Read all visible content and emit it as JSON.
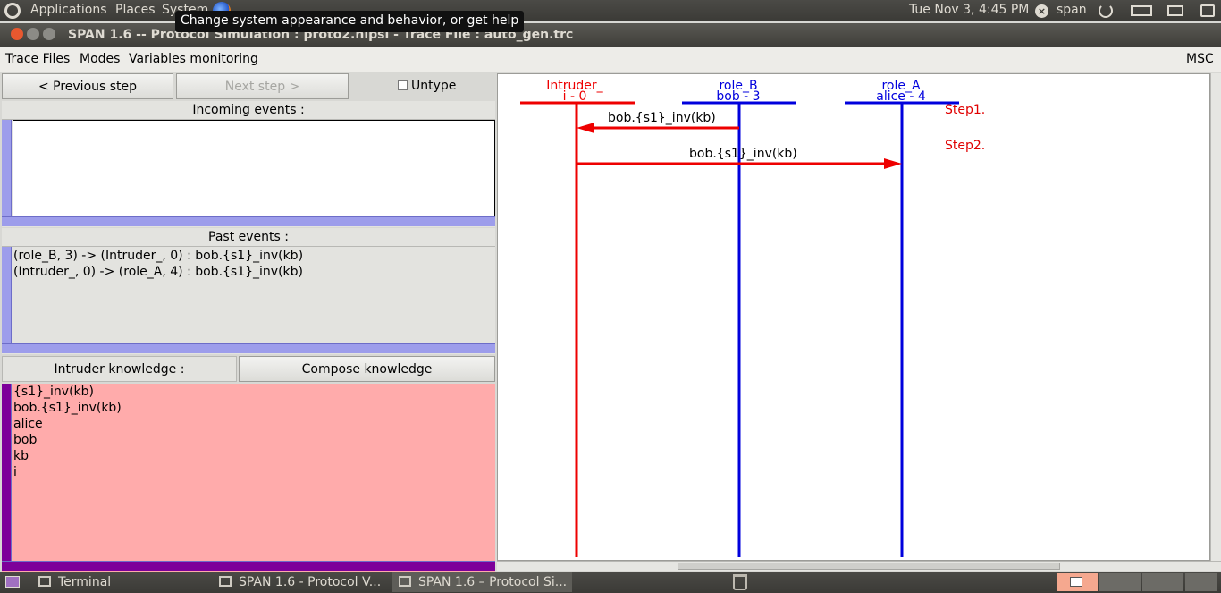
{
  "top_panel": {
    "menus": [
      "Applications",
      "Places",
      "System"
    ],
    "clock": "Tue Nov  3,  4:45 PM",
    "user": "span",
    "tooltip": "Change system appearance and behavior, or get help"
  },
  "window": {
    "title": "SPAN 1.6 -- Protocol Simulation : proto2.hlpsl - Trace File : auto_gen.trc"
  },
  "menu_bar": {
    "items": [
      "Trace Files",
      "Modes",
      "Variables monitoring"
    ],
    "right": "MSC"
  },
  "controls": {
    "previous_step": "< Previous step",
    "next_step": "Next step >",
    "untype": "Untype"
  },
  "incoming_events": {
    "label": "Incoming events :",
    "items": []
  },
  "past_events": {
    "label": "Past events :",
    "items": [
      "(role_B, 3) -> (Intruder_, 0) : bob.{s1}_inv(kb)",
      "(Intruder_, 0) -> (role_A, 4) : bob.{s1}_inv(kb)"
    ]
  },
  "knowledge": {
    "label": "Intruder knowledge :",
    "compose_button": "Compose knowledge",
    "items": [
      "{s1}_inv(kb)",
      "bob.{s1}_inv(kb)",
      "alice",
      "bob",
      "kb",
      "i"
    ]
  },
  "msc": {
    "lifelines": [
      {
        "role": "Intruder_",
        "instance": "i - 0",
        "color": "#ee0000"
      },
      {
        "role": "role_B",
        "instance": "bob - 3",
        "color": "#0000dd"
      },
      {
        "role": "role_A",
        "instance": "alice - 4",
        "color": "#0000dd"
      }
    ],
    "steps": [
      "Step1.",
      "Step2."
    ],
    "messages": [
      {
        "label": "bob.{s1}_inv(kb)",
        "from": "role_B",
        "to": "Intruder_"
      },
      {
        "label": "bob.{s1}_inv(kb)",
        "from": "Intruder_",
        "to": "role_A"
      }
    ],
    "message_color": "#ee0000"
  },
  "taskbar": {
    "tasks": [
      "Terminal",
      "SPAN 1.6 - Protocol V...",
      "SPAN 1.6 – Protocol Si..."
    ]
  }
}
